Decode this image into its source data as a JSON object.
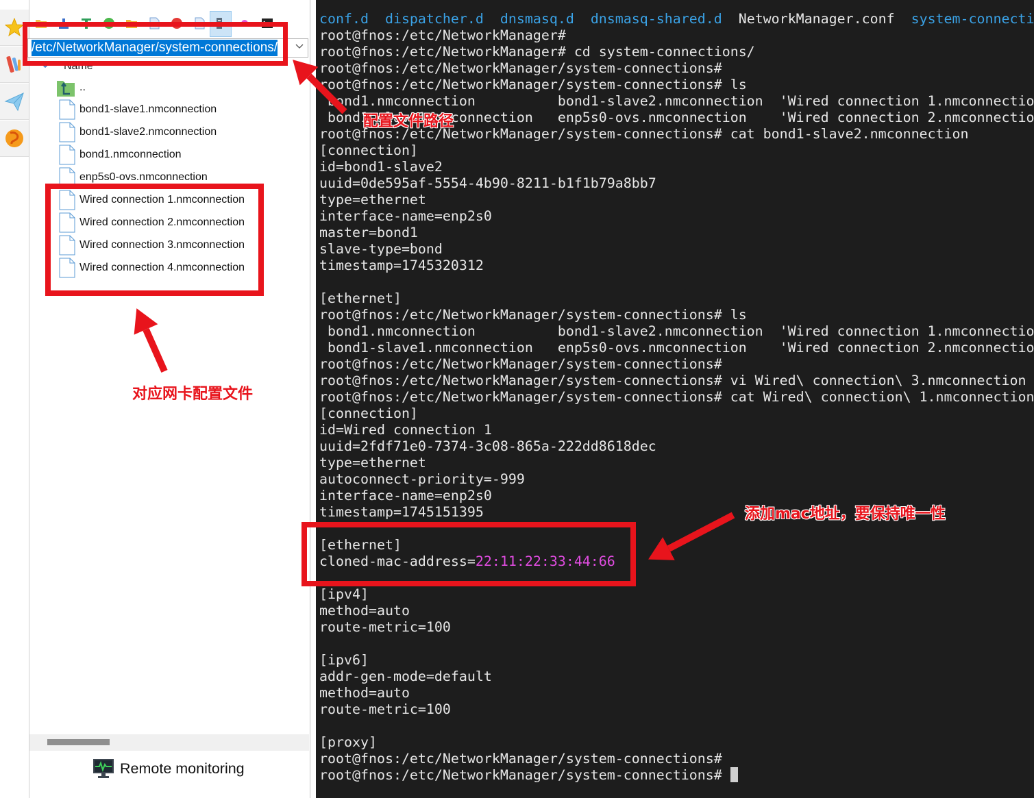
{
  "toolbar": {
    "icons": [
      "open-folder-icon",
      "upload-icon",
      "text-editor-icon",
      "refresh-icon",
      "new-folder-icon",
      "new-file-icon",
      "delete-icon",
      "properties-icon",
      "device-icon",
      "settings-icon",
      "terminal-icon"
    ]
  },
  "side_strip": {
    "icons": [
      "favorites-star-icon",
      "tools-icon",
      "send-icon",
      "browser-icon"
    ]
  },
  "path_bar": {
    "value": "/etc/NetworkManager/system-connections/"
  },
  "file_list": {
    "header": "Name",
    "parent": "..",
    "files": [
      {
        "name": "bond1-slave1.nmconnection"
      },
      {
        "name": "bond1-slave2.nmconnection"
      },
      {
        "name": "bond1.nmconnection"
      },
      {
        "name": "enp5s0-ovs.nmconnection"
      },
      {
        "name": "Wired connection 1.nmconnection"
      },
      {
        "name": "Wired connection 2.nmconnection"
      },
      {
        "name": "Wired connection 3.nmconnection"
      },
      {
        "name": "Wired connection 4.nmconnection"
      }
    ]
  },
  "status": {
    "remote_monitoring": "Remote monitoring"
  },
  "annotations": {
    "path_label": "配置文件路径",
    "files_label": "对应网卡配置文件",
    "mac_label": "添加mac地址，要保持唯一性"
  },
  "terminal": {
    "listing": [
      "conf.d",
      "dispatcher.d",
      "dnsmasq.d",
      "dnsmasq-shared.d",
      "NetworkManager.conf",
      "system-connecti"
    ],
    "lines": [
      "root@fnos:/etc/NetworkManager#",
      "root@fnos:/etc/NetworkManager# cd system-connections/",
      "root@fnos:/etc/NetworkManager/system-connections#",
      "root@fnos:/etc/NetworkManager/system-connections# ls",
      " bond1.nmconnection          bond1-slave2.nmconnection  'Wired connection 1.nmconnectio",
      " bond1-slave1.nmconnection   enp5s0-ovs.nmconnection    'Wired connection 2.nmconnectio",
      "root@fnos:/etc/NetworkManager/system-connections# cat bond1-slave2.nmconnection",
      "[connection]",
      "id=bond1-slave2",
      "uuid=0de595af-5554-4b90-8211-b1f1b79a8bb7",
      "type=ethernet",
      "interface-name=enp2s0",
      "master=bond1",
      "slave-type=bond",
      "timestamp=1745320312",
      "",
      "[ethernet]",
      "root@fnos:/etc/NetworkManager/system-connections# ls",
      " bond1.nmconnection          bond1-slave2.nmconnection  'Wired connection 1.nmconnectio",
      " bond1-slave1.nmconnection   enp5s0-ovs.nmconnection    'Wired connection 2.nmconnectio",
      "root@fnos:/etc/NetworkManager/system-connections#",
      "root@fnos:/etc/NetworkManager/system-connections# vi Wired\\ connection\\ 3.nmconnection",
      "root@fnos:/etc/NetworkManager/system-connections# cat Wired\\ connection\\ 1.nmconnection",
      "[connection]",
      "id=Wired connection 1",
      "uuid=2fdf71e0-7374-3c08-865a-222dd8618dec",
      "type=ethernet",
      "autoconnect-priority=-999",
      "interface-name=enp2s0",
      "timestamp=1745151395",
      "",
      "[ethernet]"
    ],
    "mac_line": {
      "key": "cloned-mac-address=",
      "value": "22:11:22:33:44:66"
    },
    "lines_after": [
      "",
      "[ipv4]",
      "method=auto",
      "route-metric=100",
      "",
      "[ipv6]",
      "addr-gen-mode=default",
      "method=auto",
      "route-metric=100",
      "",
      "[proxy]",
      "root@fnos:/etc/NetworkManager/system-connections#",
      "root@fnos:/etc/NetworkManager/system-connections# "
    ]
  },
  "colors": {
    "terminal_bg": "#1d1d1d",
    "terminal_text": "#e6e6e6",
    "directory": "#3aa2e6",
    "mac_value": "#e04ce0",
    "annotation_red": "#e8141c",
    "selection": "#0078d7"
  }
}
